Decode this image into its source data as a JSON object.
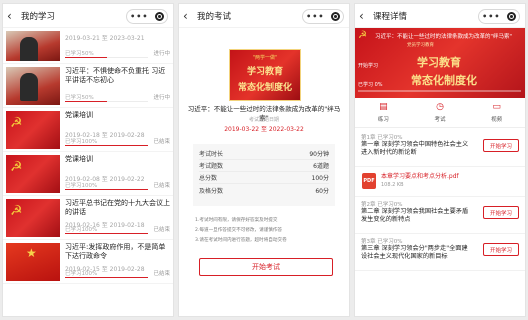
{
  "panel1": {
    "nav_title": "我的学习",
    "courses": [
      {
        "title": "",
        "date": "2019-03-21 至 2023-03-21",
        "progress_text": "已学习50%",
        "progress": 0.5,
        "status": "进行中"
      },
      {
        "title": "习近平：不惧使命不负重托 习近平讲话不忘初心",
        "date": "",
        "progress_text": "已学习50%",
        "progress": 0.5,
        "status": "进行中"
      },
      {
        "title": "党课培训",
        "date": "2019-02-18 至 2019-02-28",
        "progress_text": "已学习100%",
        "progress": 1.0,
        "status": "已结束"
      },
      {
        "title": "党课培训",
        "date": "2019-02-08 至 2019-02-22",
        "progress_text": "已学习100%",
        "progress": 1.0,
        "status": "已结束"
      },
      {
        "title": "习近平总书记在党的十九大会议上的讲话",
        "date": "2019-02-16 至 2019-02-18",
        "progress_text": "已学习100%",
        "progress": 1.0,
        "status": "已结束"
      },
      {
        "title": "习近平:发挥政府作用，不是简单下达行政命令",
        "date": "2019-02-15 至 2019-02-28",
        "progress_text": "已学习100%",
        "progress": 1.0,
        "status": "已结束"
      }
    ]
  },
  "panel2": {
    "nav_title": "我的考试",
    "banner_line1": "\"两学一做\"",
    "banner_line2": "学习教育",
    "banner_line3": "常态化制度化",
    "exam_title": "习近平：不能让一些过时的法律条款成为改革的\"绊马索\"",
    "exam_subtitle": "考试起始日期",
    "exam_date": "2019-03-22 至 2022-03-22",
    "rows": [
      {
        "k": "考试时长",
        "v": "90分钟"
      },
      {
        "k": "考试题数",
        "v": "6道题"
      },
      {
        "k": "总分数",
        "v": "100分"
      },
      {
        "k": "及格分数",
        "v": "60分"
      }
    ],
    "notes": [
      "1.考试时间有限，请保存好答案及时提交",
      "2.每道一旦作答提交不可修改，请谨慎作答",
      "3.请在考试时间内进行答题，超时将自动交卷"
    ],
    "start_label": "开始考试"
  },
  "panel3": {
    "nav_title": "课程详情",
    "hero_title": "习近平：不能让一些过时的法律条款成为改革的\"绊马索\"",
    "hero_sub": "党员学习教育",
    "hero_big1": "学习教育",
    "hero_big2": "常态化制度化",
    "hero_started": "开始学习",
    "hero_learned": "已学习 0%",
    "hero_progress": 0.0,
    "tabs": [
      {
        "icon": "book-icon",
        "glyph": "▤",
        "label": "练习"
      },
      {
        "icon": "clock-icon",
        "glyph": "◷",
        "label": "考试"
      },
      {
        "icon": "monitor-icon",
        "glyph": "▭",
        "label": "视频"
      }
    ],
    "chapter1": {
      "label": "第1章 已学习0%",
      "name": "第一章 深刻学习领会中国特色社会主义进入新时代的新论断",
      "button": "开始学习"
    },
    "file": {
      "icon_text": "PDF",
      "name": "本章学习要点和考点分析.pdf",
      "size": "108.2 KB"
    },
    "chapter2": {
      "label": "第2章 已学习0%",
      "name": "第二章 深刻学习领会我国社会主要矛盾发生变化的新特点",
      "button": "开始学习"
    },
    "chapter3": {
      "label": "第3章 已学习0%",
      "name": "第三章 深刻学习领会分\"两步走\"全面建设社会主义现代化国家的新目标",
      "button": "开始学习"
    }
  }
}
